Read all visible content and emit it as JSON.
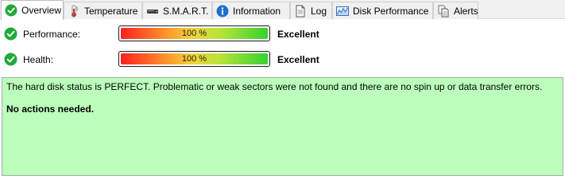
{
  "tabs": [
    {
      "label": "Overview",
      "icon": "green-check-icon",
      "active": true
    },
    {
      "label": "Temperature",
      "icon": "thermometer-icon",
      "active": false
    },
    {
      "label": "S.M.A.R.T.",
      "icon": "disk-icon",
      "active": false
    },
    {
      "label": "Information",
      "icon": "info-icon",
      "active": false
    },
    {
      "label": "Log",
      "icon": "document-icon",
      "active": false
    },
    {
      "label": "Disk Performance",
      "icon": "chart-icon",
      "active": false
    },
    {
      "label": "Alerts",
      "icon": "alerts-icon",
      "active": false
    }
  ],
  "status": {
    "performance": {
      "label": "Performance:",
      "value_text": "100 %",
      "value": 100,
      "rating": "Excellent"
    },
    "health": {
      "label": "Health:",
      "value_text": "100 %",
      "value": 100,
      "rating": "Excellent"
    }
  },
  "message": {
    "text": "The hard disk status is PERFECT. Problematic or weak sectors were not found and there are no spin up or data transfer errors.",
    "action": "No actions needed.",
    "background_color": "#bcffbc"
  },
  "colors": {
    "check_green": "#22a83a",
    "info_blue": "#1e6fd0"
  }
}
